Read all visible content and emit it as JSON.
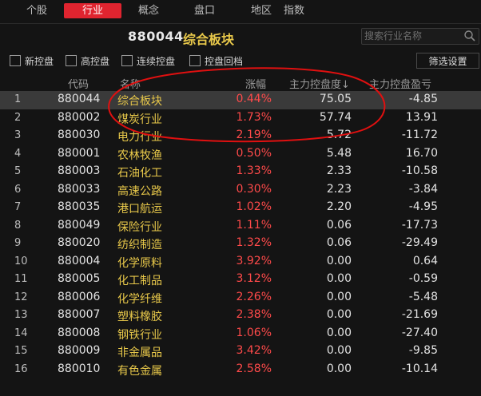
{
  "tabs": [
    {
      "label": "个股"
    },
    {
      "label": "行业",
      "active": true
    },
    {
      "label": "概念"
    },
    {
      "label": "盘口"
    },
    {
      "label": "地区"
    },
    {
      "label": "指数"
    }
  ],
  "header": {
    "code": "880044",
    "name": "综合板块"
  },
  "search": {
    "placeholder": "搜索行业名称",
    "icon": "search-icon"
  },
  "filters": [
    {
      "label": "新控盘",
      "checked": false
    },
    {
      "label": "高控盘",
      "checked": false
    },
    {
      "label": "连续控盘",
      "checked": false
    },
    {
      "label": "控盘回档",
      "checked": false
    }
  ],
  "filter_button": "筛选设置",
  "columns": {
    "code": "代码",
    "name": "名称",
    "change": "涨幅",
    "control": "主力控盘度↓",
    "pnl": "主力控盘盈亏"
  },
  "rows": [
    {
      "idx": "1",
      "code": "880044",
      "name": "综合板块",
      "change": "0.44%",
      "control": "75.05",
      "pnl": "-4.85",
      "selected": true
    },
    {
      "idx": "2",
      "code": "880002",
      "name": "煤炭行业",
      "change": "1.73%",
      "control": "57.74",
      "pnl": "13.91"
    },
    {
      "idx": "3",
      "code": "880030",
      "name": "电力行业",
      "change": "2.19%",
      "control": "5.72",
      "pnl": "-11.72"
    },
    {
      "idx": "4",
      "code": "880001",
      "name": "农林牧渔",
      "change": "0.50%",
      "control": "5.48",
      "pnl": "16.70"
    },
    {
      "idx": "5",
      "code": "880003",
      "name": "石油化工",
      "change": "1.33%",
      "control": "2.33",
      "pnl": "-10.58"
    },
    {
      "idx": "6",
      "code": "880033",
      "name": "高速公路",
      "change": "0.30%",
      "control": "2.23",
      "pnl": "-3.84"
    },
    {
      "idx": "7",
      "code": "880035",
      "name": "港口航运",
      "change": "1.02%",
      "control": "2.20",
      "pnl": "-4.95"
    },
    {
      "idx": "8",
      "code": "880049",
      "name": "保险行业",
      "change": "1.11%",
      "control": "0.06",
      "pnl": "-17.73"
    },
    {
      "idx": "9",
      "code": "880020",
      "name": "纺织制造",
      "change": "1.32%",
      "control": "0.06",
      "pnl": "-29.49"
    },
    {
      "idx": "10",
      "code": "880004",
      "name": "化学原料",
      "change": "3.92%",
      "control": "0.00",
      "pnl": "0.64"
    },
    {
      "idx": "11",
      "code": "880005",
      "name": "化工制品",
      "change": "3.12%",
      "control": "0.00",
      "pnl": "-0.59"
    },
    {
      "idx": "12",
      "code": "880006",
      "name": "化学纤维",
      "change": "2.26%",
      "control": "0.00",
      "pnl": "-5.48"
    },
    {
      "idx": "13",
      "code": "880007",
      "name": "塑料橡胶",
      "change": "2.38%",
      "control": "0.00",
      "pnl": "-21.69"
    },
    {
      "idx": "14",
      "code": "880008",
      "name": "钢铁行业",
      "change": "1.06%",
      "control": "0.00",
      "pnl": "-27.40"
    },
    {
      "idx": "15",
      "code": "880009",
      "name": "非金属品",
      "change": "3.42%",
      "control": "0.00",
      "pnl": "-9.85"
    },
    {
      "idx": "16",
      "code": "880010",
      "name": "有色金属",
      "change": "2.58%",
      "control": "0.00",
      "pnl": "-10.14"
    }
  ],
  "colors": {
    "accent": "#e0242f",
    "up": "#ff4a4a",
    "name": "#e8c84a",
    "annotation": "#e01010"
  }
}
